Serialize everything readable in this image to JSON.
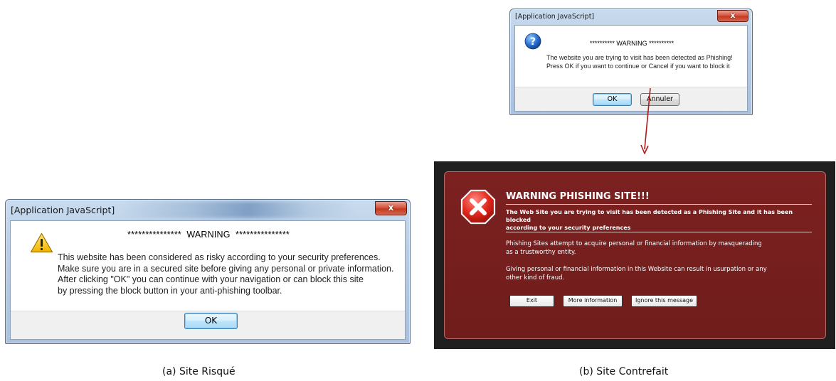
{
  "dialog_a": {
    "title": "[Application JavaScript]",
    "close_label": "x",
    "icon": "warning-triangle-icon",
    "headline": "***************  WARNING  ***************",
    "body_lines": [
      "This website has been considered as risky according to your security preferences.",
      "Make sure you are in a secured site before giving any personal or private information.",
      "After clicking \"OK\" you can continue with your navigation or can block this site",
      "by pressing the block button in your anti-phishing toolbar."
    ],
    "ok_label": "OK"
  },
  "dialog_b1": {
    "title": "[Application JavaScript]",
    "close_label": "x",
    "icon": "question-icon",
    "headline": "********** WARNING **********",
    "body_lines": [
      "The website you are trying to visit has been detected as Phishing!",
      "Press OK if you want to continue or Cancel if you want to block it"
    ],
    "ok_label": "OK",
    "cancel_label": "Annuler"
  },
  "panel_b2": {
    "icon": "error-x-icon",
    "title": "WARNING PHISHING SITE!!!",
    "subtitle_lines": [
      "The Web Site you are trying to visit has been detected as a Phishing Site and it has been blocked",
      "according to your security preferences"
    ],
    "paragraph1_lines": [
      "Phishing Sites attempt to acquire personal or financial information by masquerading",
      "as a trustworthy entity."
    ],
    "paragraph2_lines": [
      "Giving personal or financial information in this Website can result in usurpation or any",
      "other kind of fraud."
    ],
    "buttons": [
      "Exit",
      "More information",
      "Ignore this message"
    ]
  },
  "captions": {
    "a": "(a) Site Risqué",
    "b": "(b) Site Contrefait"
  },
  "colors": {
    "panel_red": "#741f1e",
    "panel_frame": "#1f1f1f",
    "arrow": "#b01a1a"
  }
}
